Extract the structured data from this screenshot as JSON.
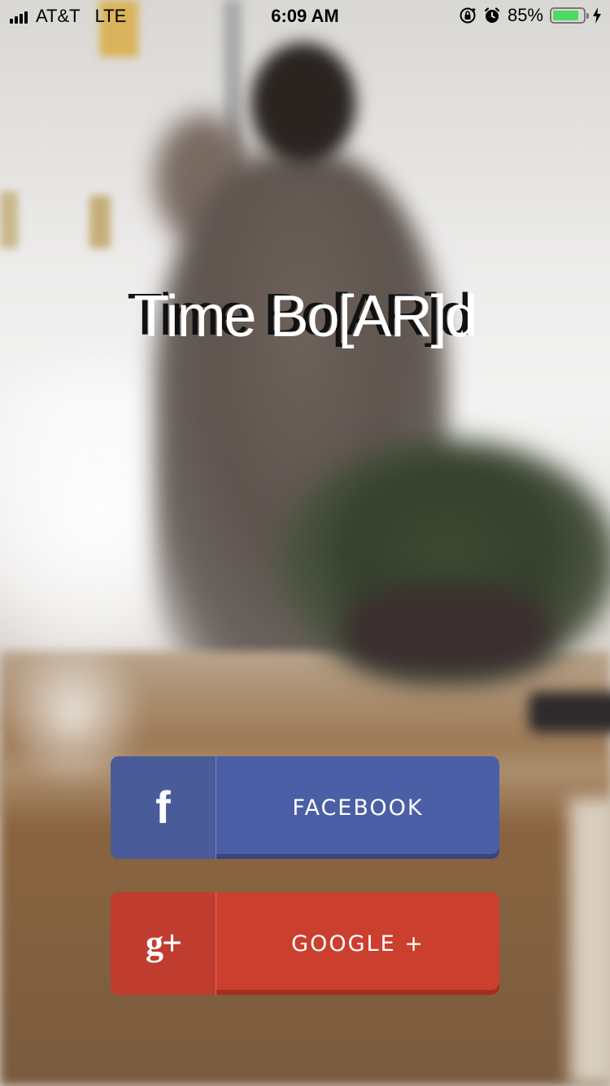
{
  "status_bar": {
    "carrier": "AT&T",
    "network": "LTE",
    "time": "6:09 AM",
    "battery_percent_label": "85%",
    "battery_level": 0.85,
    "battery_color": "#4cd964"
  },
  "app": {
    "title": "Time Bo[AR]d"
  },
  "login": {
    "facebook": {
      "label": "FACEBOOK",
      "icon": "facebook-icon",
      "icon_glyph": "f",
      "color": "#4a5fa6"
    },
    "google": {
      "label": "GOOGLE +",
      "icon": "google-plus-icon",
      "icon_glyph": "g+",
      "color": "#cb3f2e"
    }
  }
}
